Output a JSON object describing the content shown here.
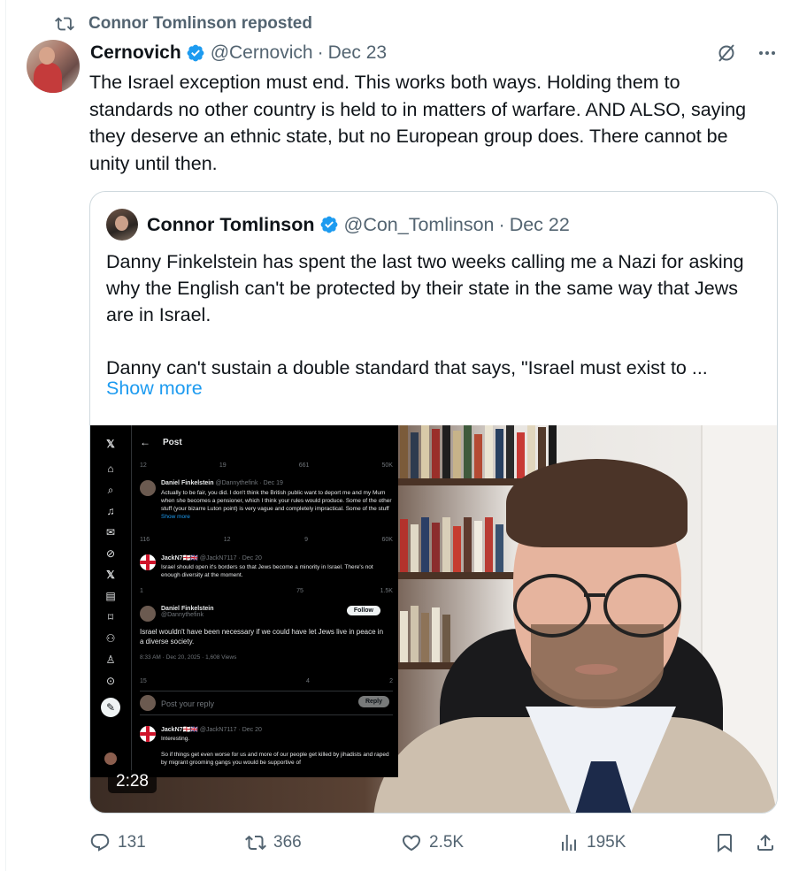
{
  "repost": {
    "label": "Connor Tomlinson reposted"
  },
  "tweet": {
    "author_name": "Cernovich",
    "handle": "@Cernovich",
    "separator": "·",
    "date": "Dec 23",
    "more_icon": "more-dots-icon",
    "grok_icon": "grok-icon",
    "text": "The Israel exception must end. This works both ways. Holding them to standards no other country is held to in matters of warfare. AND ALSO, saying they deserve an ethnic state, but no European group does. There cannot be unity until then."
  },
  "quote": {
    "author_name": "Connor Tomlinson",
    "handle": "@Con_Tomlinson",
    "separator": "·",
    "date": "Dec 22",
    "text": "Danny Finkelstein has spent the last two weeks calling me a Nazi for asking why the English can't be protected by their state in the same way that Jews are in Israel.\n\nDanny can't sustain a double standard that says, \"Israel must exist to ...",
    "show_more": "Show more",
    "video_duration": "2:28",
    "inset": {
      "title": "Post",
      "row1": [
        "12",
        "19",
        "661",
        "50K"
      ],
      "post1": {
        "name": "Daniel Finkelstein",
        "meta": "@Dannythefink · Dec 19",
        "text": "Actually to be fair, you did. I don't think the British public want to deport me and my Mum when she becomes a pensioner, which I think your rules would produce. Some of the other stuff (your bizarre Luton point) is very vague and completely impractical. Some of the stuff",
        "show_more": "Show more"
      },
      "row2": [
        "116",
        "12",
        "9",
        "60K"
      ],
      "post2": {
        "name": "JackN7🏴󠁧󠁢󠁥󠁮󠁧󠁿🇬🇧",
        "meta": "@JackN7117 · Dec 20",
        "text": "Israel should open it's borders so that Jews become a minority in Israel. There's not enough diversity at the moment."
      },
      "row3": [
        "1",
        "",
        "75",
        "1.5K"
      ],
      "post3": {
        "name": "Daniel Finkelstein",
        "meta": "@Dannythefink",
        "follow": "Follow",
        "text": "Israel wouldn't have been necessary if we could have let Jews live in peace in a diverse society.",
        "stats": "8:33 AM · Dec 20, 2025 · 1,608 Views"
      },
      "row4": [
        "15",
        "",
        "4",
        "2"
      ],
      "reply_placeholder": "Post your reply",
      "reply_button": "Reply",
      "post4": {
        "name": "JackN7🏴󠁧󠁢󠁥󠁮󠁧󠁿🇬🇧",
        "meta": "@JackN7117 · Dec 20",
        "text1": "Interesting.",
        "text2": "So if things get even worse for us and more of our people get killed by jihadists and raped by migrant grooming gangs you would be supportive of"
      }
    }
  },
  "actions": {
    "replies": "131",
    "reposts": "366",
    "likes": "2.5K",
    "views": "195K"
  },
  "colors": {
    "link": "#1d9bf0",
    "muted": "#536471",
    "verified": "#1d9bf0"
  }
}
